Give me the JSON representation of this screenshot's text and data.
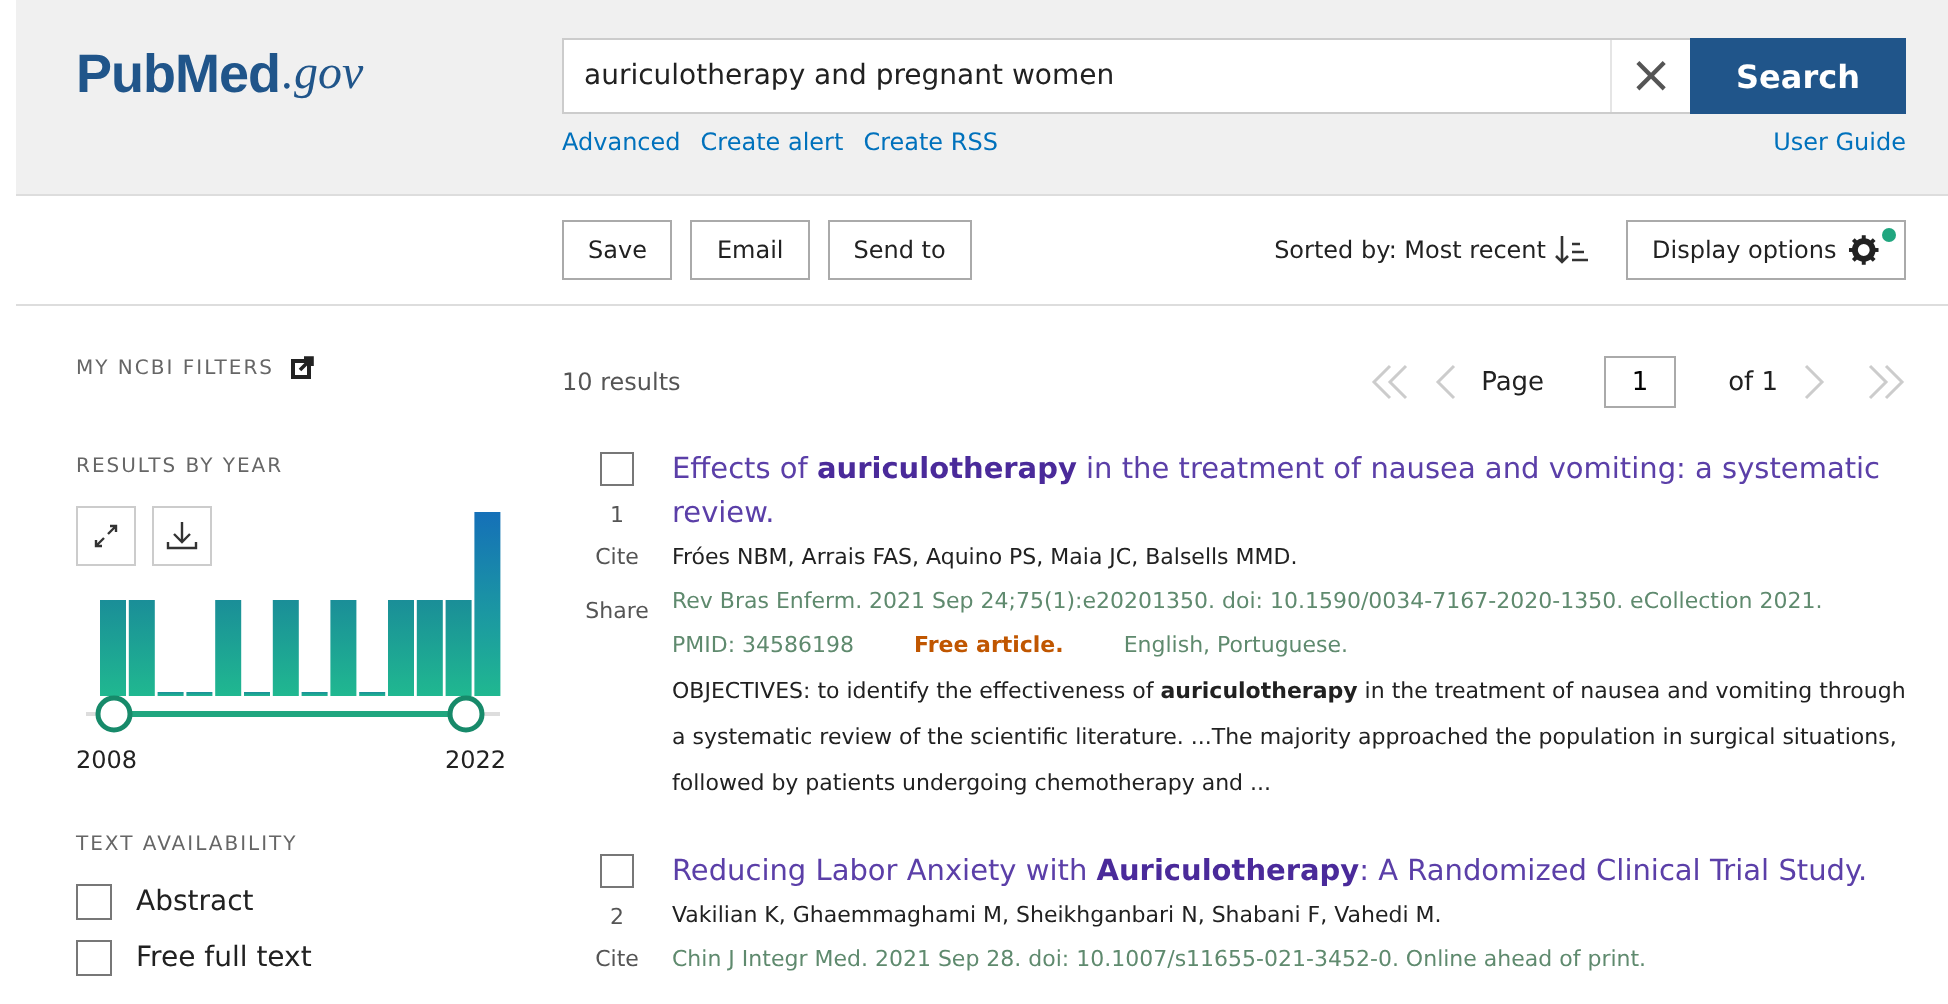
{
  "logo": {
    "brand": "PubMed",
    "suffix": ".gov"
  },
  "search": {
    "value": "auriculotherapy and pregnant women",
    "clear": "×",
    "button": "Search"
  },
  "search_links": [
    "Advanced",
    "Create alert",
    "Create RSS"
  ],
  "user_guide": "User Guide",
  "actions": [
    "Save",
    "Email",
    "Send to"
  ],
  "sort": {
    "label": "Sorted by: Most recent"
  },
  "display_options": {
    "label": "Display options",
    "notification": true
  },
  "sidebar": {
    "ncbi_filters": "MY NCBI FILTERS",
    "results_by_year": {
      "title": "RESULTS BY YEAR",
      "start": "2008",
      "end": "2022"
    },
    "text_availability": {
      "title": "TEXT AVAILABILITY",
      "options": [
        {
          "label": "Abstract",
          "checked": false
        },
        {
          "label": "Free full text",
          "checked": false
        }
      ]
    }
  },
  "results_count": "10 results",
  "pagination": {
    "page_label": "Page",
    "page": "1",
    "of": "of 1"
  },
  "results": [
    {
      "number": "1",
      "checked": false,
      "title": "Effects of **auriculotherapy** in the treatment of nausea and vomiting: a systematic review.",
      "authors": "Fróes NBM, Arrais FAS, Aquino PS, Maia JC, Balsells MMD.",
      "citation": "Rev Bras Enferm. 2021 Sep 24;75(1):e20201350. doi: 10.1590/0034-7167-2020-1350. eCollection 2021.",
      "pmid": "PMID: 34586198",
      "free": "Free article.",
      "language": "English, Portuguese.",
      "snippet": "OBJECTIVES: to identify the effectiveness of **auriculotherapy** in the treatment of nausea and vomiting through a systematic review of the scientific literature. ...The majority approached the population in surgical situations, followed by patients undergoing chemotherapy and ...",
      "actions": [
        "Cite",
        "Share"
      ]
    },
    {
      "number": "2",
      "checked": false,
      "title": "Reducing Labor Anxiety with **Auriculotherapy**: A Randomized Clinical Trial Study.",
      "authors": "Vakilian K, Ghaemmaghami M, Sheikhganbari N, Shabani F, Vahedi M.",
      "citation": "Chin J Integr Med. 2021 Sep 28. doi: 10.1007/s11655-021-3452-0. Online ahead of print.",
      "actions": [
        "Cite"
      ]
    }
  ]
}
